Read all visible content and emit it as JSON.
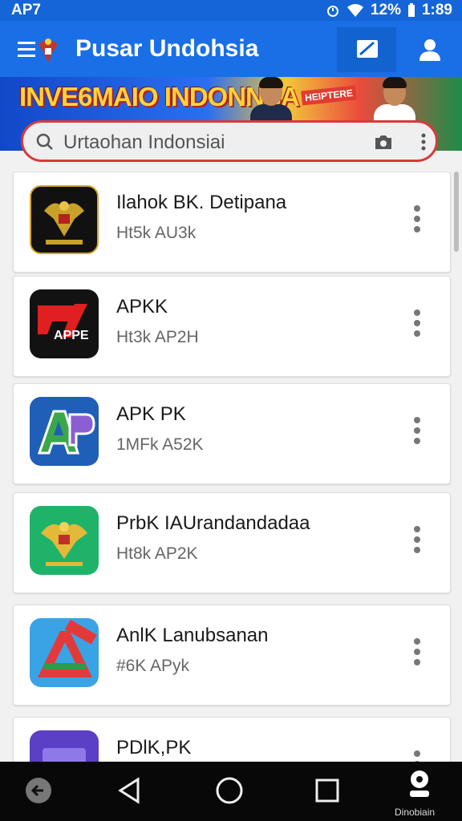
{
  "status_bar": {
    "left_text": "AP7",
    "battery": "12%",
    "time": "1:89"
  },
  "app_bar": {
    "title": "Pusar Undohsia",
    "edit_icon": "edit-icon",
    "profile_icon": "person-icon"
  },
  "banner": {
    "headline": "INVE6MAIO INDONNSA",
    "tag": "HEIPTERE"
  },
  "search": {
    "placeholder": "Urtaohan Indonsiai"
  },
  "apps": [
    {
      "name": "Ilahok BK. Detipana",
      "sub": "Ht5k AU3k",
      "icon": "garuda-emblem-black-icon"
    },
    {
      "name": "APKK",
      "sub": "Ht3k AP2H",
      "icon": "apps-red-black-icon"
    },
    {
      "name": "APK PK",
      "sub": "1MFk A52K",
      "icon": "ap-blue-icon"
    },
    {
      "name": "PrbK IAUrandandadaa",
      "sub": "Ht8k AP2K",
      "icon": "garuda-emblem-green-icon"
    },
    {
      "name": "AnlK Lanubsanan",
      "sub": "#6K APyk",
      "icon": "triangle-a-icon"
    },
    {
      "name": "PDlK,PK",
      "sub": "",
      "icon": "purple-app-icon"
    }
  ],
  "nav": {
    "label": "Dinobiain"
  },
  "colors": {
    "primary": "#1a6fe6",
    "status": "#1565d8",
    "search_border": "#d93a3a"
  }
}
